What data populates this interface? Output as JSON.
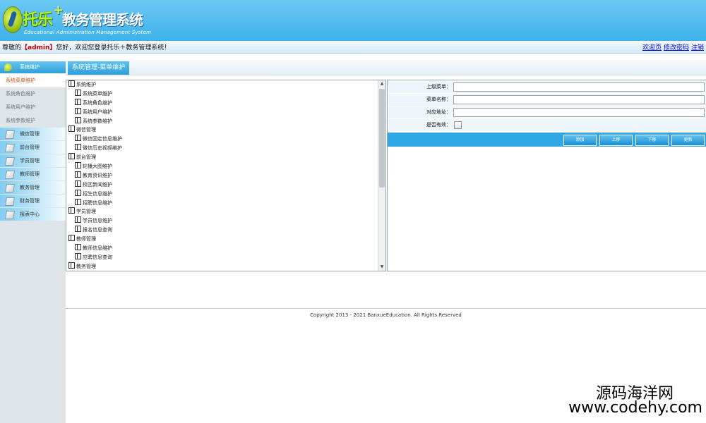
{
  "header": {
    "brand": "托乐",
    "brand_plus": "+",
    "title": "教务管理系统",
    "subtitle": "Educational Administration Management System"
  },
  "welcome": {
    "prefix": "尊敬的",
    "user": "【admin】",
    "suffix": "您好，欢迎您登录托乐＋教务管理系统！",
    "links": [
      "欢迎页",
      "修改密码",
      "注销"
    ]
  },
  "sidebar": {
    "active_group": "系统维护",
    "sub_items": [
      "系统菜单维护",
      "系统角色维护",
      "系统用户维护",
      "系统参数维护"
    ],
    "groups": [
      "微信管理",
      "前台管理",
      "学员管理",
      "教师管理",
      "教务管理",
      "财务管理",
      "报表中心"
    ]
  },
  "page_title": "系统管理-菜单维护",
  "tree": {
    "rows": [
      {
        "type": "folder",
        "label": "系统维护"
      },
      {
        "type": "leaf",
        "label": "系统菜单维护"
      },
      {
        "type": "leaf",
        "label": "系统角色维护"
      },
      {
        "type": "leaf",
        "label": "系统用户维护"
      },
      {
        "type": "leaf",
        "label": "系统参数维护"
      },
      {
        "type": "folder",
        "label": "微信管理"
      },
      {
        "type": "leaf",
        "label": "微信固定信息维护"
      },
      {
        "type": "leaf",
        "label": "微信历史视频维护"
      },
      {
        "type": "folder",
        "label": "前台管理"
      },
      {
        "type": "leaf",
        "label": "轮播大图维护"
      },
      {
        "type": "leaf",
        "label": "教育资讯维护"
      },
      {
        "type": "leaf",
        "label": "校区新闻维护"
      },
      {
        "type": "leaf",
        "label": "招生信息维护"
      },
      {
        "type": "leaf",
        "label": "招聘信息维护"
      },
      {
        "type": "folder",
        "label": "学员管理"
      },
      {
        "type": "leaf",
        "label": "学员信息维护"
      },
      {
        "type": "leaf",
        "label": "报名信息查询"
      },
      {
        "type": "folder",
        "label": "教师管理"
      },
      {
        "type": "leaf",
        "label": "教师信息维护"
      },
      {
        "type": "leaf",
        "label": "应聘信息查询"
      },
      {
        "type": "folder",
        "label": "教务管理"
      }
    ]
  },
  "form": {
    "fields": [
      {
        "label": "上级菜单：",
        "value": ""
      },
      {
        "label": "菜单名称：",
        "value": ""
      },
      {
        "label": "对应地址：",
        "value": ""
      }
    ],
    "active_label": "是否有效：",
    "active_checked": false,
    "buttons": [
      "添加",
      "上移",
      "下移",
      "更新"
    ]
  },
  "footer": "Copyright 2013 - 2021 BanxueEducation. All Rights Reserved",
  "watermark": {
    "site_name": "源码海洋网",
    "url": "www.codehy.com"
  }
}
